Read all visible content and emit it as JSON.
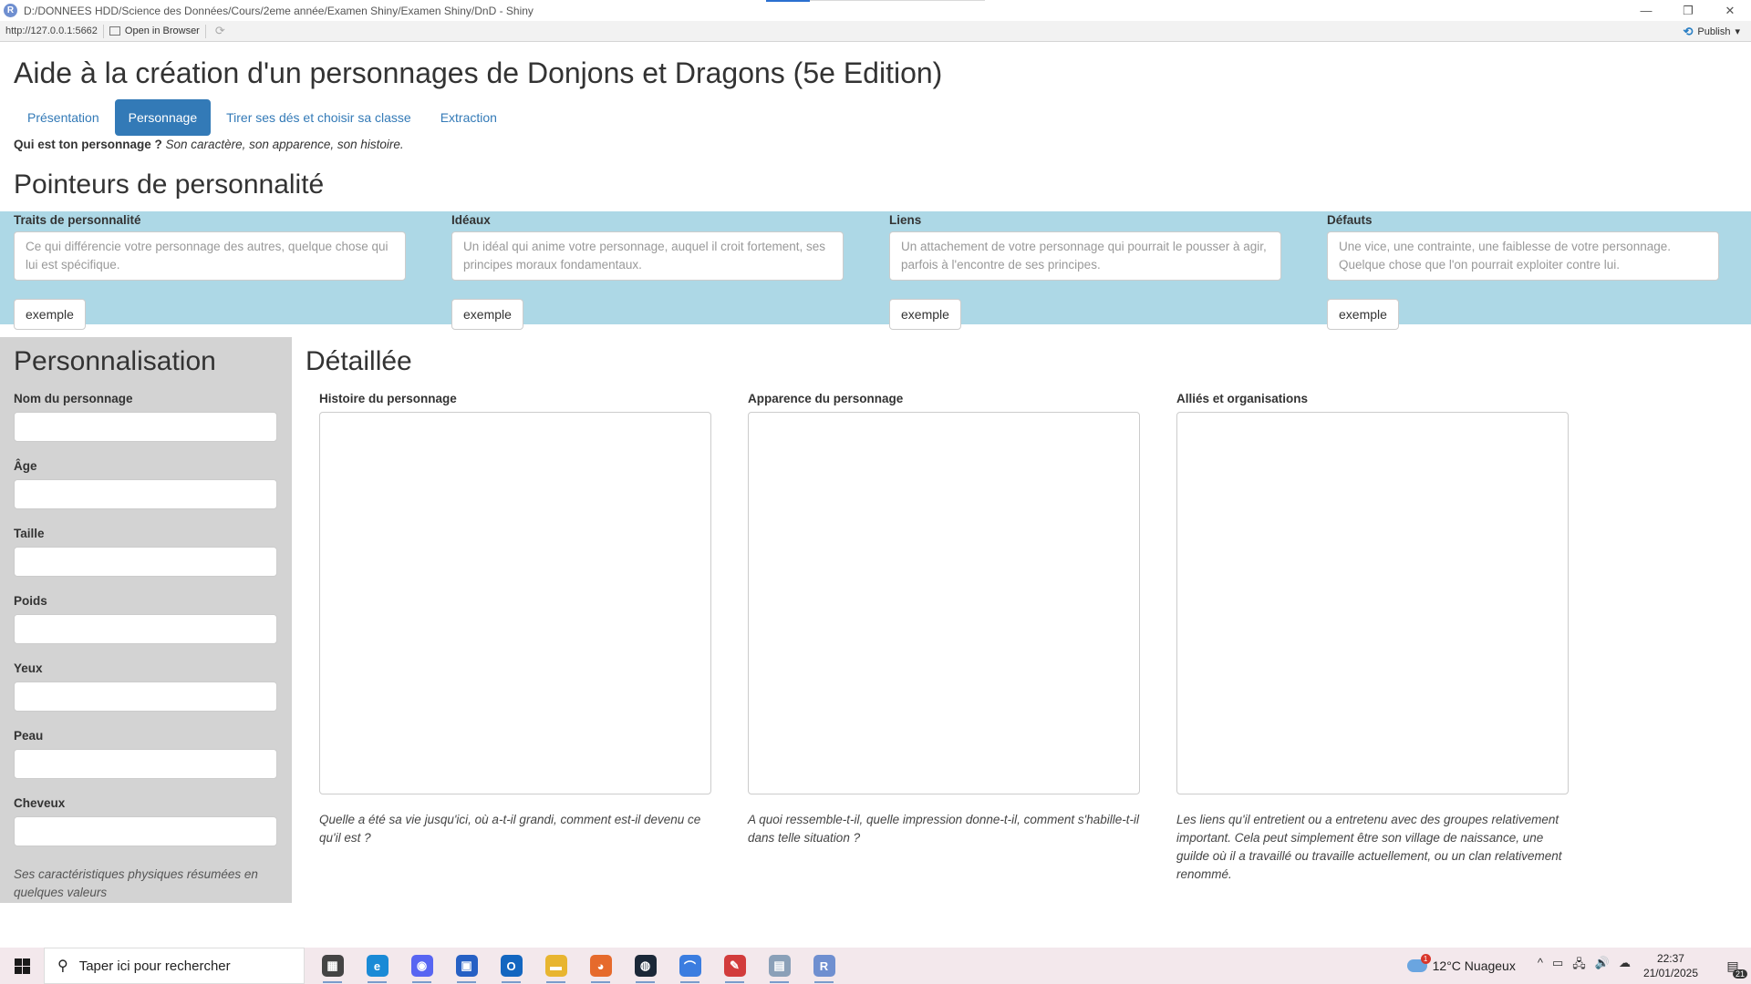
{
  "window": {
    "title": "D:/DONNEES HDD/Science des Données/Cours/2eme année/Examen Shiny/Examen Shiny/DnD - Shiny",
    "logo_letter": "R",
    "controls": [
      "—",
      "❐",
      "✕"
    ]
  },
  "viewer_toolbar": {
    "url": "http://127.0.0.1:5662",
    "open_in_browser": "Open in Browser",
    "publish": "Publish"
  },
  "app": {
    "title": "Aide à la création d'un personnages de Donjons et Dragons (5e Edition)",
    "tabs": [
      {
        "label": "Présentation",
        "active": false
      },
      {
        "label": "Personnage",
        "active": true
      },
      {
        "label": "Tirer ses dés et choisir sa classe",
        "active": false
      },
      {
        "label": "Extraction",
        "active": false
      }
    ],
    "intro_bold": "Qui est ton personnage ?",
    "intro_italic": "Son caractère, son apparence, son histoire.",
    "pointers_title": "Pointeurs de personnalité",
    "pointers": [
      {
        "label": "Traits de personnalité",
        "placeholder": "Ce qui différencie votre personnage des autres, quelque chose qui lui est spécifique.",
        "button": "exemple"
      },
      {
        "label": "Idéaux",
        "placeholder": "Un idéal qui anime votre personnage, auquel il croit fortement, ses principes moraux fondamentaux.",
        "button": "exemple"
      },
      {
        "label": "Liens",
        "placeholder": "Un attachement de votre personnage qui pourrait le pousser à agir, parfois à l'encontre de ses principes.",
        "button": "exemple"
      },
      {
        "label": "Défauts",
        "placeholder": "Une vice, une contrainte, une faiblesse de votre personnage. Quelque chose que l'on pourrait exploiter contre lui.",
        "button": "exemple"
      }
    ],
    "pointers_bg": "#add8e6",
    "sidebar": {
      "title": "Personnalisation",
      "fields": [
        {
          "label": "Nom du personnage",
          "value": ""
        },
        {
          "label": "Âge",
          "value": ""
        },
        {
          "label": "Taille",
          "value": ""
        },
        {
          "label": "Poids",
          "value": ""
        },
        {
          "label": "Yeux",
          "value": ""
        },
        {
          "label": "Peau",
          "value": ""
        },
        {
          "label": "Cheveux",
          "value": ""
        }
      ],
      "note": "Ses caractéristiques physiques résumées en quelques valeurs",
      "bg": "#d3d3d3"
    },
    "detail": {
      "title": "Détaillée",
      "sections": [
        {
          "label": "Histoire du personnage",
          "value": "",
          "help": "Quelle a été sa vie jusqu'ici, où a-t-il grandi, comment est-il devenu ce qu'il est ?"
        },
        {
          "label": "Apparence du personnage",
          "value": "",
          "help": "A quoi ressemble-t-il, quelle impression donne-t-il, comment s'habille-t-il dans telle situation ?"
        },
        {
          "label": "Alliés et organisations",
          "value": "",
          "help": "Les liens qu'il entretient ou a entretenu avec des groupes relativement important. Cela peut simplement être son village de naissance, une guilde où il a travaillé ou travaille actuellement, ou un clan relativement renommé."
        }
      ]
    },
    "accent": "#337ab7"
  },
  "taskbar": {
    "search_placeholder": "Taper ici pour rechercher",
    "apps": [
      {
        "name": "task-view",
        "glyph": "▦",
        "color": "#444444"
      },
      {
        "name": "edge",
        "glyph": "e",
        "color": "#1a8ad6"
      },
      {
        "name": "discord",
        "glyph": "◉",
        "color": "#5865f2"
      },
      {
        "name": "store",
        "glyph": "▣",
        "color": "#2660c4"
      },
      {
        "name": "outlook",
        "glyph": "O",
        "color": "#1366c0"
      },
      {
        "name": "file-explorer",
        "glyph": "▬",
        "color": "#e8b530"
      },
      {
        "name": "firefox",
        "glyph": "◕",
        "color": "#e66a2c"
      },
      {
        "name": "steam",
        "glyph": "◍",
        "color": "#1b2838"
      },
      {
        "name": "arc",
        "glyph": "⌒",
        "color": "#3b7de0"
      },
      {
        "name": "rstudio-alt",
        "glyph": "✎",
        "color": "#d23c3c"
      },
      {
        "name": "images",
        "glyph": "▤",
        "color": "#8aa0b8"
      },
      {
        "name": "r",
        "glyph": "R",
        "color": "#6f8fd0"
      }
    ],
    "weather_alert": "1",
    "weather": "12°C  Nuageux",
    "tray_icons": [
      "^",
      "▭",
      "🖧",
      "🔊",
      "☁"
    ],
    "time": "22:37",
    "date": "21/01/2025",
    "notifications": "21"
  }
}
